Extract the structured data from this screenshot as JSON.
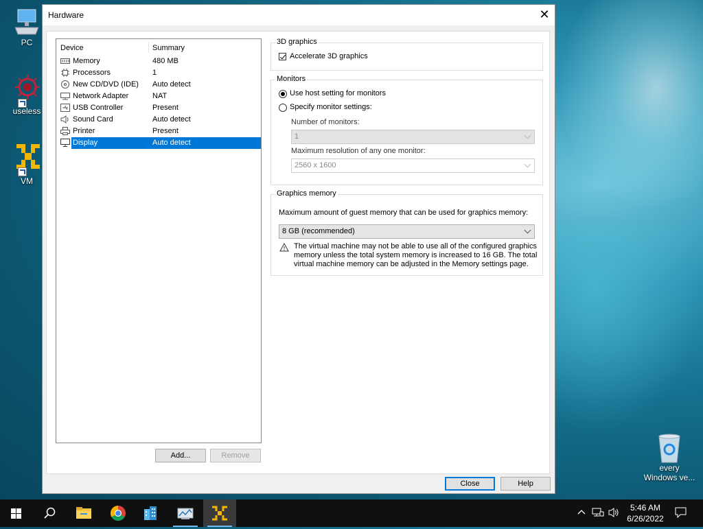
{
  "desktop": {
    "icons": [
      {
        "label": "PC",
        "icon": "computer-icon"
      },
      {
        "label": "useless",
        "icon": "virus-icon"
      },
      {
        "label": "VM",
        "icon": "vmware-icon"
      },
      {
        "label": "every\nWindows ve...",
        "icon": "recycle-bin-icon"
      }
    ]
  },
  "dialog": {
    "title": "Hardware",
    "device_list": {
      "headers": {
        "device": "Device",
        "summary": "Summary"
      },
      "rows": [
        {
          "device": "Memory",
          "summary": "480 MB",
          "icon": "memory-icon"
        },
        {
          "device": "Processors",
          "summary": "1",
          "icon": "processor-icon"
        },
        {
          "device": "New CD/DVD (IDE)",
          "summary": "Auto detect",
          "icon": "cd-icon"
        },
        {
          "device": "Network Adapter",
          "summary": "NAT",
          "icon": "network-icon"
        },
        {
          "device": "USB Controller",
          "summary": "Present",
          "icon": "usb-icon"
        },
        {
          "device": "Sound Card",
          "summary": "Auto detect",
          "icon": "speaker-icon"
        },
        {
          "device": "Printer",
          "summary": "Present",
          "icon": "printer-icon"
        },
        {
          "device": "Display",
          "summary": "Auto detect",
          "icon": "monitor-icon",
          "selected": true
        }
      ]
    },
    "buttons": {
      "add": "Add...",
      "remove": "Remove",
      "close": "Close",
      "help": "Help"
    },
    "graphics3d": {
      "legend": "3D graphics",
      "accelerate_label": "Accelerate 3D graphics",
      "accelerate_checked": true
    },
    "monitors": {
      "legend": "Monitors",
      "use_host_label": "Use host setting for monitors",
      "specify_label": "Specify monitor settings:",
      "selected": "use_host",
      "num_monitors_label": "Number of monitors:",
      "num_monitors_value": "1",
      "max_res_label": "Maximum resolution of any one monitor:",
      "max_res_value": "2560 x 1600"
    },
    "graphics_memory": {
      "legend": "Graphics memory",
      "label": "Maximum amount of guest memory that can be used for graphics memory:",
      "value": "8 GB (recommended)",
      "warning_line1": "The virtual machine may not be able to use all of the configured graphics",
      "warning_line2": "memory unless the total system memory is increased to 16 GB. The total",
      "warning_line3": "virtual machine memory can be adjusted in the Memory settings page."
    }
  },
  "taskbar": {
    "items": [
      "start-icon",
      "search-icon",
      "file-explorer-icon",
      "chrome-icon",
      "buildings-app-icon",
      "control-panel-icon",
      "vmware-icon"
    ],
    "time": "5:46 AM",
    "date": "6/26/2022"
  },
  "colors": {
    "accent": "#0078d7",
    "taskbar": "#101010"
  }
}
